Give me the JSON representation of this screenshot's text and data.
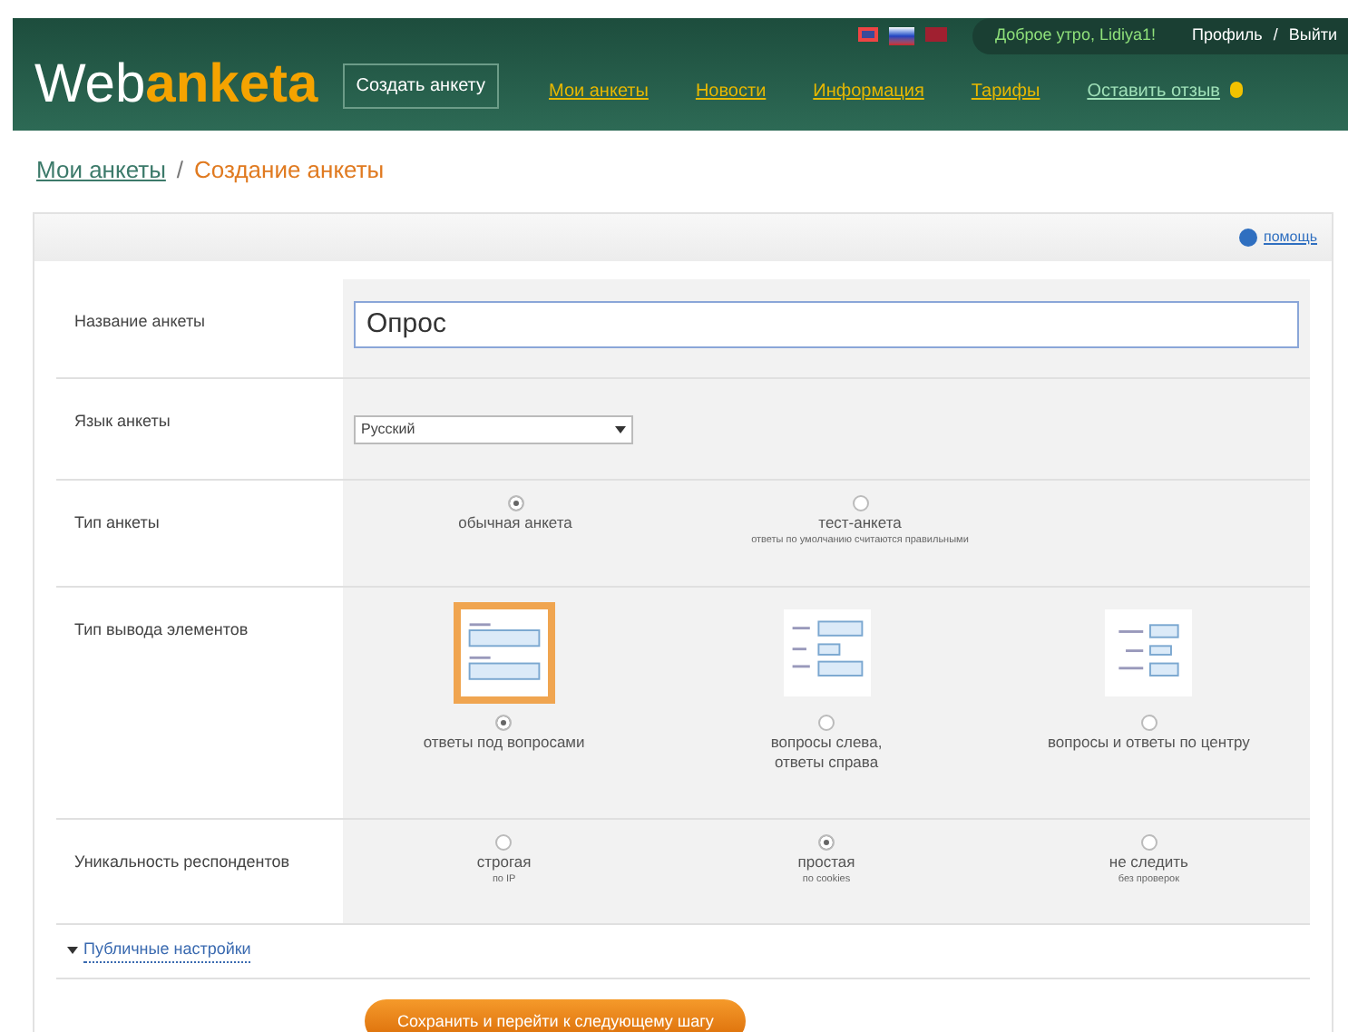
{
  "header": {
    "logo_plain": "Web",
    "logo_bold": "anketa",
    "create_button": "Создать анкету",
    "nav": [
      "Мои анкеты",
      "Новости",
      "Информация",
      "Тарифы",
      "Оставить отзыв"
    ],
    "flags": [
      {
        "kind": "uk"
      },
      {
        "kind": "ru"
      },
      {
        "kind": "lv"
      }
    ],
    "greeting": "Доброе утро, Lidiya1!",
    "profile": "Профиль",
    "separator": "/",
    "logout": "Выйти"
  },
  "breadcrumb": {
    "parent": "Мои анкеты",
    "separator": "/",
    "current": "Создание анкеты"
  },
  "help": "помощь",
  "form": [
    {
      "kind": "text",
      "label": "Название анкеты",
      "value": "Опрос"
    },
    {
      "kind": "select",
      "label": "Язык анкеты",
      "value": "Русский"
    },
    {
      "kind": "radio",
      "label": "Тип анкеты",
      "options": [
        {
          "label": "обычная анкета",
          "selected": true
        },
        {
          "label": "тест-анкета",
          "note": "ответы по умолчанию считаются правильными",
          "selected": false
        }
      ]
    },
    {
      "kind": "layout",
      "label": "Тип вывода элементов",
      "options": [
        {
          "kind": "below",
          "label": "ответы под вопросами",
          "selected": true
        },
        {
          "kind": "left",
          "label": "вопросы слева,\nответы справа",
          "selected": false
        },
        {
          "kind": "center",
          "label": "вопросы и ответы по центру",
          "selected": false
        }
      ]
    },
    {
      "kind": "radio",
      "label": "Уникальность респондентов",
      "options": [
        {
          "label": "строгая",
          "note": "по IP",
          "selected": false
        },
        {
          "label": "простая",
          "note": "по cookies",
          "selected": true
        },
        {
          "label": "не следить",
          "note": "без проверок",
          "selected": false
        }
      ]
    }
  ],
  "public_settings": {
    "label": "Публичные настройки",
    "expanded": false
  },
  "submit": "Сохранить и перейти к следующему шагу"
}
